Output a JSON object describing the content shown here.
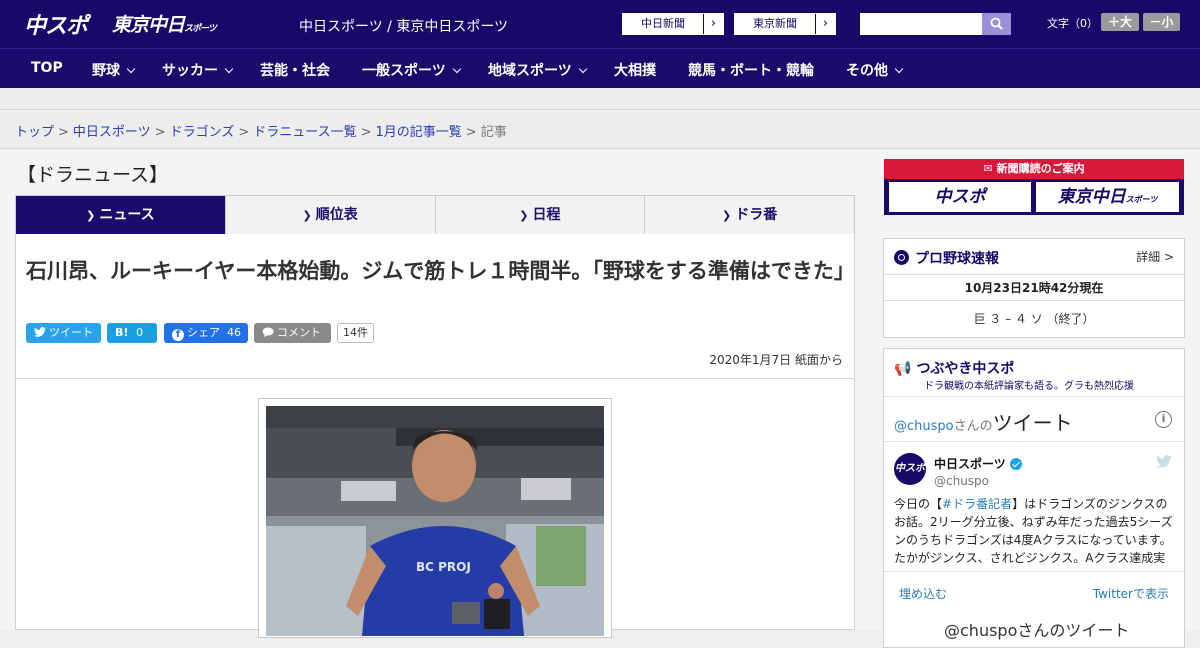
{
  "header": {
    "logo_chuspo": "中スポ",
    "logo_tokyo": "東京中日",
    "logo_tokyo_sub": "スポーツ",
    "site_names": "中日スポーツ / 東京中日スポーツ",
    "paper_links": [
      "中日新聞",
      "東京新聞"
    ],
    "search_placeholder": "",
    "font_size_label": "文字（0）",
    "font_plus": "＋大",
    "font_minus": "－小"
  },
  "nav": {
    "items": [
      {
        "label": "TOP",
        "dropdown": false
      },
      {
        "label": "野球",
        "dropdown": true
      },
      {
        "label": "サッカー",
        "dropdown": true
      },
      {
        "label": "芸能・社会",
        "dropdown": false
      },
      {
        "label": "一般スポーツ",
        "dropdown": true
      },
      {
        "label": "地域スポーツ",
        "dropdown": true
      },
      {
        "label": "大相撲",
        "dropdown": false
      },
      {
        "label": "競馬・ボート・競輪",
        "dropdown": false
      },
      {
        "label": "その他",
        "dropdown": true
      }
    ]
  },
  "breadcrumb": {
    "links": [
      "トップ",
      "中日スポーツ",
      "ドラゴンズ",
      "ドラニュース一覧",
      "1月の記事一覧"
    ],
    "separator": ">",
    "current": "記事"
  },
  "section": {
    "title": "【ドラニュース】",
    "tabs": [
      "ニュース",
      "順位表",
      "日程",
      "ドラ番"
    ],
    "active_tab": 0
  },
  "article": {
    "headline": "石川昂、ルーキーイヤー本格始動。ジムで筋トレ１時間半。「野球をする準備はできた」",
    "share": {
      "tweet": "ツイート",
      "hatena_label": "B!",
      "hatena_count": "0",
      "facebook_label": "シェア",
      "facebook_count": "46",
      "comment_label": "コメント",
      "comment_count": "14件"
    },
    "dateline": "2020年1月7日 紙面から"
  },
  "sidebar": {
    "ad": {
      "heading": "新聞購読のご案内",
      "buttons": [
        "中スポ",
        "東京中日"
      ],
      "button_sub": "スポーツ"
    },
    "baseball": {
      "title": "プロ野球速報",
      "detail": "詳細 >",
      "timestamp": "10月23日21時42分現在",
      "score": "巨 ３ – ４ ソ （終了）"
    },
    "tsubuyaki": {
      "title": "つぶやき中スポ",
      "subtitle": "ドラ観戦の本紙評論家も語る。グラも熱烈応援",
      "feed_prefix": "@chuspo",
      "feed_mid": "さんの",
      "feed_big": "ツイート",
      "info": "i",
      "tweet": {
        "avatar_text": "中スポ",
        "name": "中日スポーツ",
        "handle": "@chuspo",
        "text_pre": "今日の【",
        "hashtag": "#ドラ番記者",
        "text_post": "】はドラゴンズのジンクスのお話。2リーグ分立後、ねずみ年だった過去5シーズンのうちドラゴンズは4度Aクラスになっています。たかがジンクス、されどジンクス。Aクラス達成実"
      },
      "embed": "埋め込む",
      "view_on_twitter": "Twitterで表示",
      "bottom": "@chuspoさんのツイート"
    }
  }
}
